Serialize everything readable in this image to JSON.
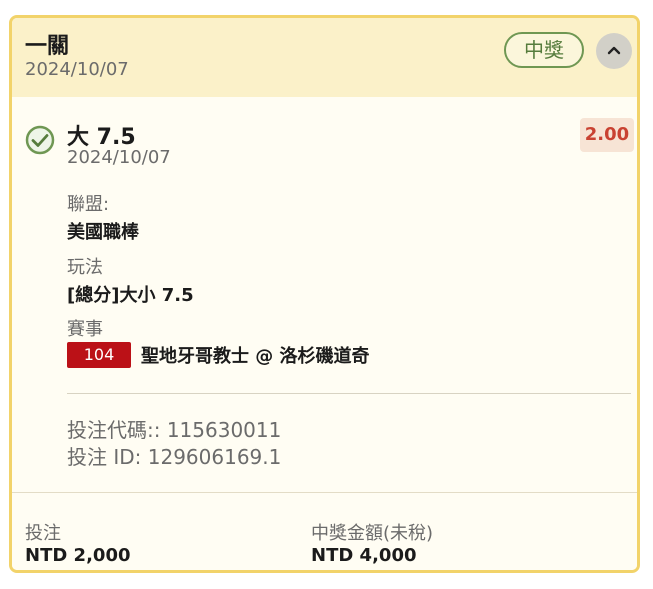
{
  "ticket": {
    "title": "一關",
    "date": "2024/10/07",
    "status": "中獎",
    "collapse_icon": "chevron-up-icon"
  },
  "selection": {
    "title": "大 7.5",
    "date": "2024/10/07",
    "odds": "2.00",
    "league_label": "聯盟:",
    "league_value": "美國職棒",
    "market_label": "玩法",
    "market_value": "[總分]大小 7.5",
    "event_label": "賽事",
    "event_code": "104",
    "event_name": "聖地牙哥教士 @ 洛杉磯道奇"
  },
  "identifiers": {
    "bet_code": "投注代碼:: 115630011",
    "bet_id": "投注 ID: 129606169.1"
  },
  "footer": {
    "stake_label": "投注",
    "stake_value": "NTD 2,000",
    "payout_label": "中獎金額(未稅)",
    "payout_value": "NTD 4,000"
  },
  "colors": {
    "border": "#f2d36a",
    "header_bg": "#fbf1c9",
    "win_green": "#567c3d",
    "odds_red": "#c94232",
    "event_red": "#bb1117"
  }
}
